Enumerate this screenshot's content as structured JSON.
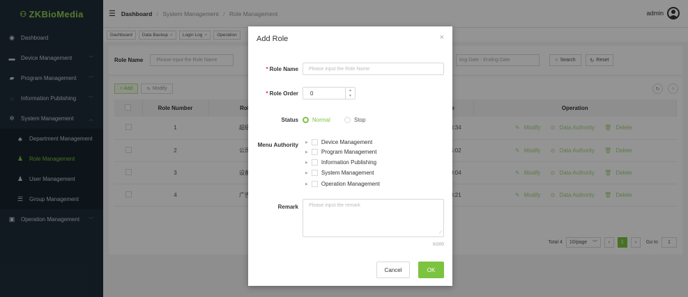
{
  "app": {
    "logo_mark": "⚇",
    "logo_text": "ZKBioMedia"
  },
  "sidebar": {
    "items": [
      {
        "label": "Dashboard",
        "icon": "dashboard-icon"
      },
      {
        "label": "Device Management",
        "icon": "device-icon"
      },
      {
        "label": "Program Management",
        "icon": "folder-icon"
      },
      {
        "label": "Information Publishing",
        "icon": "publish-icon"
      },
      {
        "label": "System Management",
        "icon": "gear-icon"
      },
      {
        "label": "Department Management",
        "icon": "org-icon"
      },
      {
        "label": "Role Management",
        "icon": "role-icon"
      },
      {
        "label": "User Management",
        "icon": "user-icon"
      },
      {
        "label": "Group Management",
        "icon": "list-icon"
      },
      {
        "label": "Operation Management",
        "icon": "operation-icon"
      }
    ]
  },
  "header": {
    "breadcrumb": [
      "Dashboard",
      "System Management",
      "Role Management"
    ],
    "user": "admin"
  },
  "tabs": [
    "Dashboard",
    "Data Backup",
    "Login Log",
    "Operation"
  ],
  "filter": {
    "role_name_label": "Role Name",
    "role_name_placeholder": "Please input the Role Name",
    "date_range": "ting Date - Ending Date",
    "search": "Search",
    "reset": "Reset"
  },
  "toolbar": {
    "add": "+ Add",
    "modify": "Modify"
  },
  "table": {
    "headers": [
      "Role Number",
      "Role Na",
      "Create Time",
      "Operation"
    ],
    "rows": [
      {
        "number": "1",
        "name": "超级管理",
        "time": "20-03-13 20:54:34"
      },
      {
        "number": "2",
        "name": "公司管理",
        "time": "20-08-03 10:55:02"
      },
      {
        "number": "3",
        "name": "设备维护",
        "time": "20-08-03 10:49:04"
      },
      {
        "number": "4",
        "name": "广告发布",
        "time": "20-08-03 10:50:21"
      }
    ],
    "ops": {
      "modify": "Modify",
      "data_authority": "Data Authority",
      "delete": "Delete"
    }
  },
  "pager": {
    "total": "Total 4",
    "page_size": "10/page",
    "current": "1",
    "goto_label": "Go to",
    "goto_value": "1"
  },
  "modal": {
    "title": "Add Role",
    "role_name_label": "Role Name",
    "role_name_placeholder": "Please input the Role Name",
    "role_order_label": "Role Order",
    "role_order_value": "0",
    "status_label": "Status",
    "status_normal": "Normal",
    "status_stop": "Stop",
    "menu_authority_label": "Menu Authority",
    "menu_items": [
      "Device Management",
      "Program Management",
      "Information Publishing",
      "System Management",
      "Operation Management"
    ],
    "remark_label": "Remark",
    "remark_placeholder": "Please input the remark",
    "remark_count": "0/200",
    "cancel": "Cancel",
    "ok": "OK"
  },
  "colors": {
    "accent": "#7cc33f",
    "sidebar_bg": "#1f2e3a",
    "required": "#f5222d"
  }
}
